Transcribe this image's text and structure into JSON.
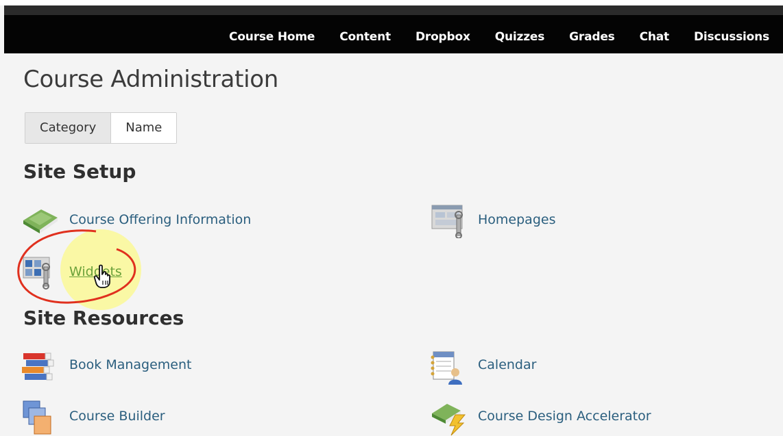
{
  "nav": {
    "items": [
      "Course Home",
      "Content",
      "Dropbox",
      "Quizzes",
      "Grades",
      "Chat",
      "Discussions"
    ]
  },
  "page": {
    "title": "Course Administration",
    "toggle": {
      "options": [
        "Category",
        "Name"
      ],
      "selected": "Category"
    }
  },
  "sections": {
    "site_setup": {
      "heading": "Site Setup",
      "items": [
        {
          "label": "Course Offering Information",
          "icon": "book-icon"
        },
        {
          "label": "Homepages",
          "icon": "homepage-tool-icon"
        },
        {
          "label": "Widgets",
          "icon": "widgets-tool-icon"
        }
      ]
    },
    "site_resources": {
      "heading": "Site Resources",
      "items": [
        {
          "label": "Book Management",
          "icon": "books-stack-icon"
        },
        {
          "label": "Calendar",
          "icon": "calendar-icon"
        },
        {
          "label": "Course Builder",
          "icon": "course-builder-icon"
        },
        {
          "label": "Course Design Accelerator",
          "icon": "design-accelerator-icon"
        }
      ]
    }
  },
  "colors": {
    "navbar": "#040404",
    "link": "#2a5e7e",
    "hover_link": "#6aa13a",
    "annotation_circle": "#e0301e",
    "highlight": "#faf896"
  }
}
